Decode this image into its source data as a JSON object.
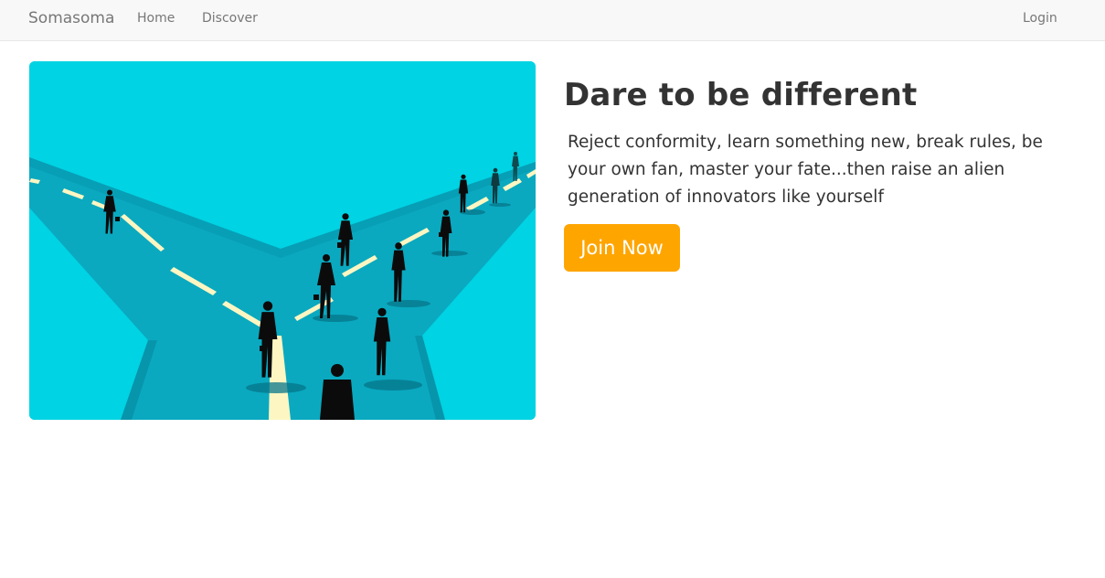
{
  "navbar": {
    "brand": "Somasoma",
    "links": [
      {
        "label": "Home"
      },
      {
        "label": "Discover"
      }
    ],
    "login_label": "Login"
  },
  "hero": {
    "image_icon": "crossroads-illustration",
    "headline": "Dare to be different",
    "tagline": "Reject conformity, learn something new, break rules, be your own fan, master your fate...then raise an alien generation of innovators like yourself",
    "cta_label": "Join Now"
  },
  "colors": {
    "navbar_bg": "#f8f8f8",
    "illustration_bg": "#00d3e3",
    "road": "#0aa9c0",
    "road_markings": "#fdf6c2",
    "cta": "#ffa500"
  }
}
